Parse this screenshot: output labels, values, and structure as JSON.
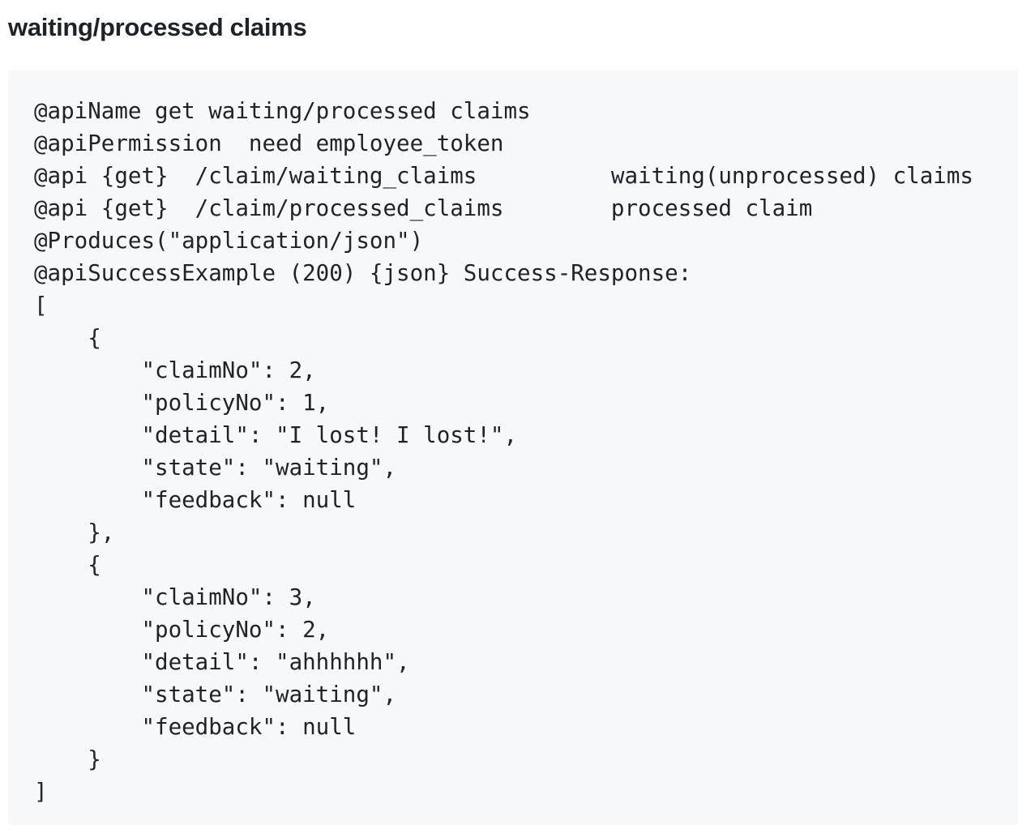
{
  "section": {
    "heading": "waiting/processed claims"
  },
  "code": {
    "lines": [
      "@apiName get waiting/processed claims",
      "@apiPermission  need employee_token",
      "@api {get}  /claim/waiting_claims          waiting(unprocessed) claims",
      "@api {get}  /claim/processed_claims        processed claim",
      "@Produces(\"application/json\")",
      "@apiSuccessExample (200) {json} Success-Response:",
      "[",
      "    {",
      "        \"claimNo\": 2,",
      "        \"policyNo\": 1,",
      "        \"detail\": \"I lost! I lost!\",",
      "        \"state\": \"waiting\",",
      "        \"feedback\": null",
      "    },",
      "    {",
      "        \"claimNo\": 3,",
      "        \"policyNo\": 2,",
      "        \"detail\": \"ahhhhhh\",",
      "        \"state\": \"waiting\",",
      "        \"feedback\": null",
      "    }",
      "]"
    ]
  }
}
